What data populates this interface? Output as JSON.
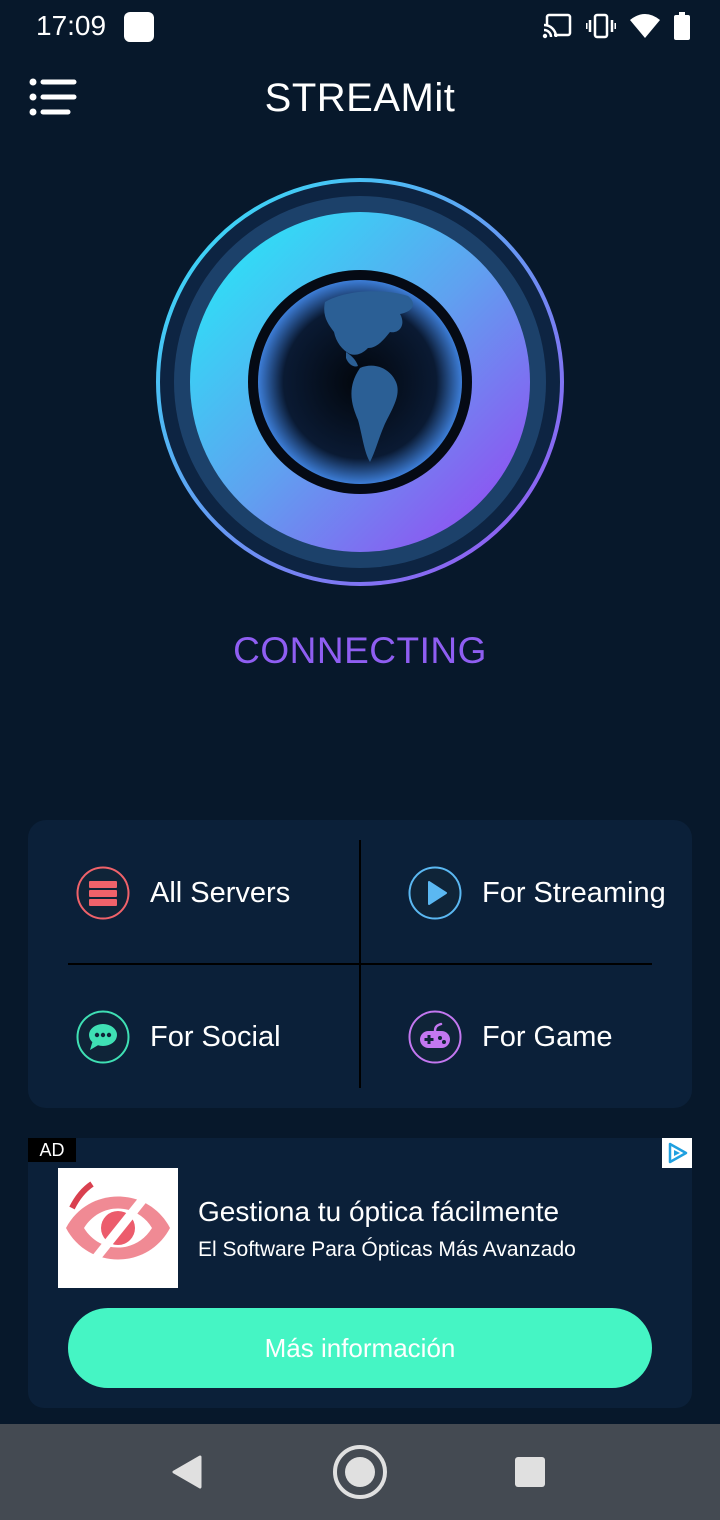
{
  "status_bar": {
    "time": "17:09",
    "icons": [
      "notification-square-icon",
      "cast-icon",
      "vibrate-icon",
      "wifi-icon",
      "battery-icon"
    ]
  },
  "header": {
    "title": "STREAMit",
    "menu_icon": "menu-list-icon"
  },
  "connection": {
    "status": "CONNECTING",
    "orb_icon": "globe-icon"
  },
  "categories": [
    {
      "label": "All Servers",
      "icon": "servers-icon",
      "color": "#f0626a"
    },
    {
      "label": "For Streaming",
      "icon": "play-icon",
      "color": "#5bb8f2"
    },
    {
      "label": "For Social",
      "icon": "chat-icon",
      "color": "#3fe0b4"
    },
    {
      "label": "For Game",
      "icon": "gamepad-icon",
      "color": "#c377f0"
    }
  ],
  "ad": {
    "badge": "AD",
    "headline": "Gestiona tu óptica fácilmente",
    "subtitle": "El Software Para Ópticas Más Avanzado",
    "cta": "Más información",
    "logo_icon": "optica-eye-logo",
    "adchoices_icon": "adchoices-icon"
  },
  "nav_bar": {
    "buttons": [
      "back-icon",
      "home-icon",
      "recents-icon"
    ]
  },
  "colors": {
    "background": "#07182b",
    "panel": "#0b2039",
    "status_text": "#8f5ef2",
    "cta": "#45f5c4",
    "nav_bar": "#444a52"
  }
}
